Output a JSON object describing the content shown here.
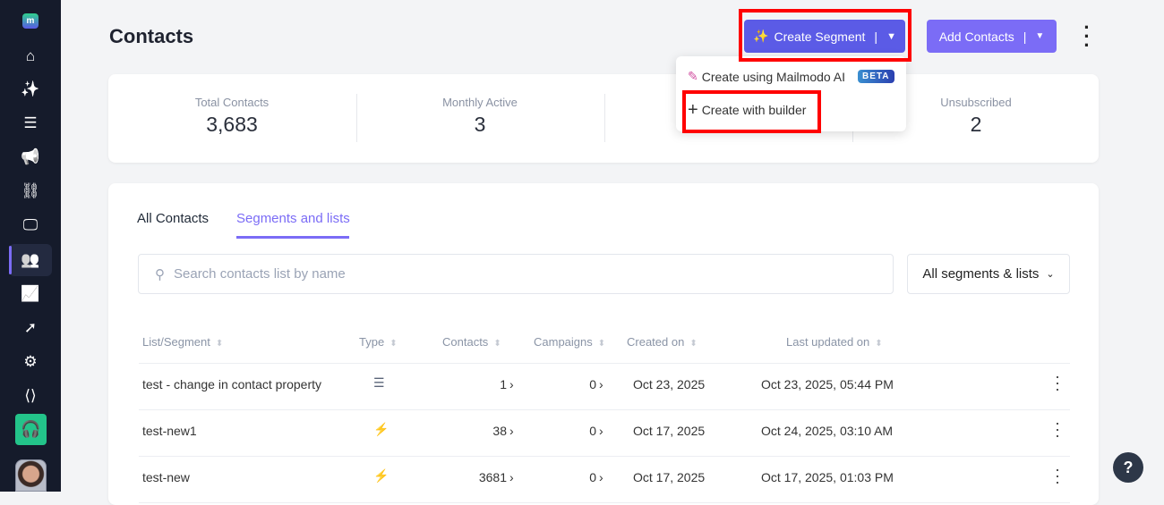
{
  "sidebar": {
    "items": [
      {
        "name": "home",
        "icon": "home-icon",
        "glyph": "⌂"
      },
      {
        "name": "magic",
        "icon": "magic-wand-icon",
        "glyph": "✨"
      },
      {
        "name": "templates",
        "icon": "document-icon",
        "glyph": "☰"
      },
      {
        "name": "campaigns",
        "icon": "megaphone-icon",
        "glyph": "📢"
      },
      {
        "name": "journeys",
        "icon": "flow-icon",
        "glyph": "⛓"
      },
      {
        "name": "widgets",
        "icon": "devices-icon",
        "glyph": "🖵"
      },
      {
        "name": "contacts",
        "icon": "users-icon",
        "glyph": "👥",
        "active": true
      },
      {
        "name": "analytics",
        "icon": "chart-icon",
        "glyph": "📈"
      },
      {
        "name": "tracking",
        "icon": "cursor-click-icon",
        "glyph": "➚"
      },
      {
        "name": "settings",
        "icon": "gear-icon",
        "glyph": "⚙"
      },
      {
        "name": "developer",
        "icon": "code-icon",
        "glyph": "⟨⟩"
      }
    ],
    "logo": "m"
  },
  "header": {
    "title": "Contacts",
    "create_segment": "Create Segment",
    "add_contacts": "Add Contacts",
    "divider": "|"
  },
  "dropdown": {
    "items": [
      {
        "label": "Create using Mailmodo AI",
        "badge": "BETA"
      },
      {
        "label": "Create with builder",
        "icon": "+"
      }
    ]
  },
  "stats": [
    {
      "label": "Total Contacts",
      "value": "3,683"
    },
    {
      "label": "Monthly Active",
      "value": "3"
    },
    {
      "label": "",
      "value": ""
    },
    {
      "label": "Unsubscribed",
      "value": "2"
    }
  ],
  "tabs": [
    {
      "label": "All Contacts"
    },
    {
      "label": "Segments and lists",
      "active": true
    }
  ],
  "search": {
    "placeholder": "Search contacts list by name"
  },
  "filter": {
    "value": "All segments & lists"
  },
  "table": {
    "headers": [
      "List/Segment",
      "Type",
      "Contacts",
      "Campaigns",
      "Created on",
      "Last updated on"
    ],
    "rows": [
      {
        "name": "test - change in contact property",
        "type": "list",
        "type_icon": "☰",
        "contacts": "1",
        "campaigns": "0",
        "created": "Oct 23, 2025",
        "updated": "Oct 23, 2025, 05:44 PM"
      },
      {
        "name": "test-new1",
        "type": "segment",
        "type_icon": "⚡",
        "contacts": "38",
        "campaigns": "0",
        "created": "Oct 17, 2025",
        "updated": "Oct 24, 2025, 03:10 AM"
      },
      {
        "name": "test-new",
        "type": "segment",
        "type_icon": "⚡",
        "contacts": "3681",
        "campaigns": "0",
        "created": "Oct 17, 2025",
        "updated": "Oct 17, 2025, 01:03 PM"
      }
    ]
  },
  "help": "?",
  "colors": {
    "primary": "#5b5be6",
    "accent": "#7b6cf6",
    "sidebar": "#151b2b",
    "support": "#23c48a"
  }
}
